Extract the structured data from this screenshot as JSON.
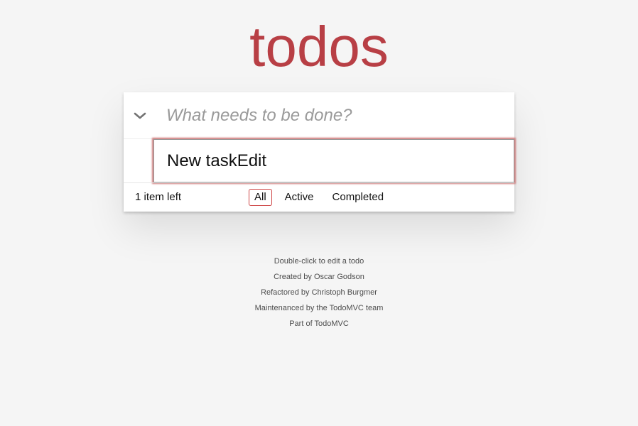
{
  "app": {
    "title": "todos"
  },
  "header": {
    "toggle_all_icon": "chevron-down-icon",
    "new_todo_placeholder": "What needs to be done?",
    "new_todo_value": ""
  },
  "todos": [
    {
      "edit_value": "New taskEdit",
      "editing": true
    }
  ],
  "footer": {
    "count_text": "1 item left",
    "filters": [
      {
        "label": "All",
        "selected": true
      },
      {
        "label": "Active",
        "selected": false
      },
      {
        "label": "Completed",
        "selected": false
      }
    ]
  },
  "info": {
    "lines": [
      "Double-click to edit a todo",
      "Created by Oscar Godson",
      "Refactored by Christoph Burgmer",
      "Maintenanced by the TodoMVC team",
      "Part of TodoMVC"
    ]
  },
  "colors": {
    "accent": "#b83f45",
    "background": "#f5f5f5",
    "selected_filter_border": "#ce4646"
  }
}
